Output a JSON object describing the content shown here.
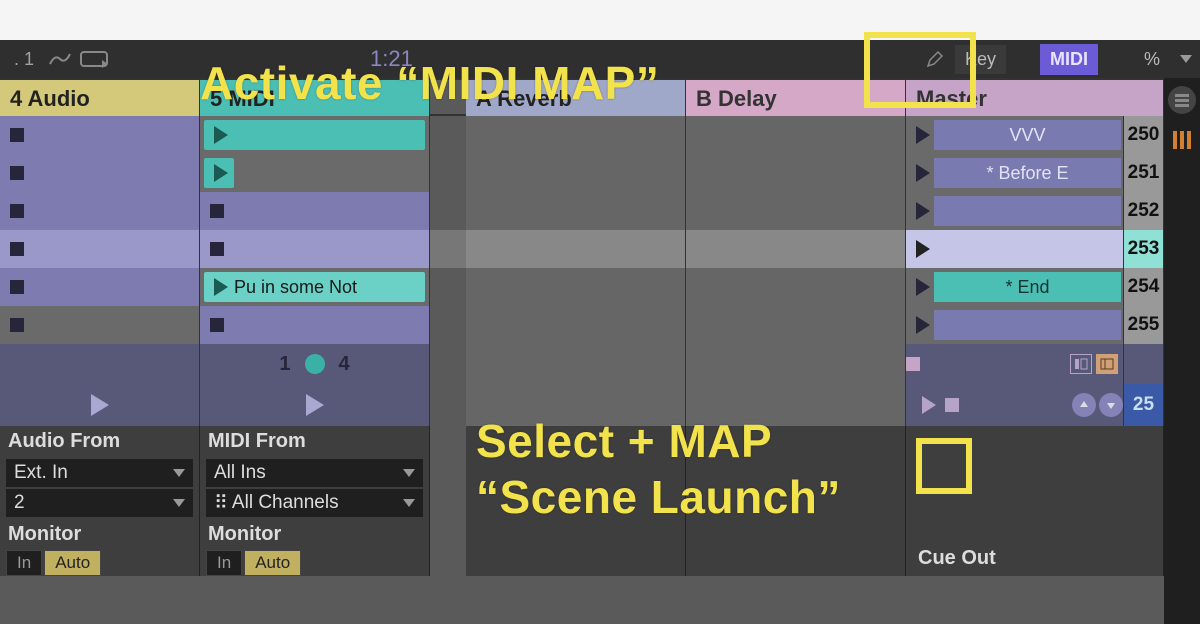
{
  "transport": {
    "position_partial": ".  1",
    "time_partial": "1:21",
    "key_label": "Key",
    "midi_label": "MIDI",
    "cpu_label": "%"
  },
  "tracks": {
    "audio": {
      "header": "4 Audio",
      "io_label": "Audio From",
      "io_type": "Ext. In",
      "io_channel": "2",
      "monitor_label": "Monitor",
      "mon_in": "In",
      "mon_auto": "Auto"
    },
    "midi": {
      "header": "5 MIDI",
      "io_label": "MIDI From",
      "io_type": "All Ins",
      "io_channel": "All Channels",
      "monitor_label": "Monitor",
      "mon_in": "In",
      "mon_auto": "Auto",
      "clip_note": "Pu in some Not",
      "status_left": "1",
      "status_right": "4"
    },
    "reverb": {
      "header": "A Reverb"
    },
    "delay": {
      "header": "B Delay"
    },
    "master": {
      "header": "Master",
      "cue_label": "Cue Out",
      "crossfade_value": "25"
    }
  },
  "scenes": [
    {
      "name": "VVV",
      "tempo": "250"
    },
    {
      "name": "* Before E",
      "tempo": "251"
    },
    {
      "name": "",
      "tempo": "252"
    },
    {
      "name": "",
      "tempo": "253",
      "selected": true
    },
    {
      "name": "* End",
      "tempo": "254"
    },
    {
      "name": "",
      "tempo": "255"
    }
  ],
  "annotations": {
    "midi_map": "Activate “MIDI MAP”",
    "scene_launch_1": "Select + MAP",
    "scene_launch_2": "“Scene Launch”"
  }
}
